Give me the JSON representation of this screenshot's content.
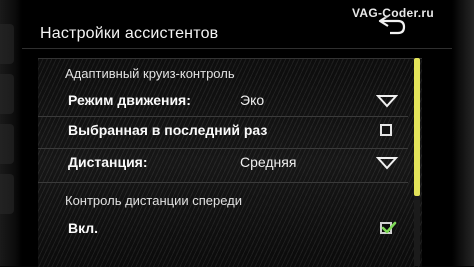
{
  "header": {
    "title": "Настройки ассистентов",
    "back_icon": "back-arrow-icon"
  },
  "watermark": "VAG-Coder.ru",
  "sections": [
    {
      "title": "Адаптивный круиз-контроль",
      "rows": [
        {
          "label": "Режим движения:",
          "value": "Эко",
          "control": "dropdown"
        },
        {
          "label": "Выбранная в последний раз",
          "control": "checkbox",
          "checked": false
        },
        {
          "label": "Дистанция:",
          "value": "Средняя",
          "control": "dropdown"
        }
      ]
    },
    {
      "title": "Контроль дистанции спереди",
      "rows": [
        {
          "label": "Вкл.",
          "control": "checkbox",
          "checked": true
        }
      ]
    }
  ],
  "colors": {
    "scroll_thumb": "#e4e45a",
    "checkmark": "#7ed957"
  }
}
